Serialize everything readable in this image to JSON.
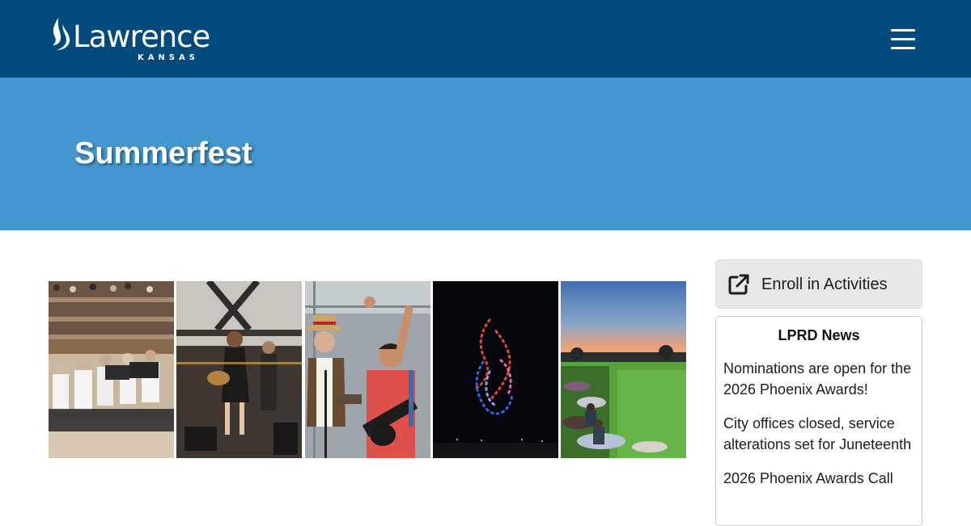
{
  "header": {
    "logo_wordmark": "Lawrence",
    "logo_subtext": "KANSAS",
    "menu_icon": "hamburger-menu-icon",
    "background_color": "#004a7c"
  },
  "hero": {
    "title": "Summerfest",
    "background_color": "#4397cf"
  },
  "gallery": {
    "photos": [
      {
        "subject": "concert band playing on outdoor stage"
      },
      {
        "subject": "woman singing and playing guitar on stage"
      },
      {
        "subject": "performers in straw boater hat and guitarist cheering"
      },
      {
        "subject": "drone show flame logo in night sky"
      },
      {
        "subject": "crowd on lawn at sunset"
      }
    ]
  },
  "sidebar": {
    "enroll": {
      "label": "Enroll in Activities",
      "icon": "external-link-icon"
    },
    "news": {
      "title": "LPRD News",
      "items": [
        "Nominations are open for the 2026 Phoenix Awards!",
        "City offices closed, service alterations set for Juneteenth",
        "2026 Phoenix Awards Call"
      ]
    }
  }
}
